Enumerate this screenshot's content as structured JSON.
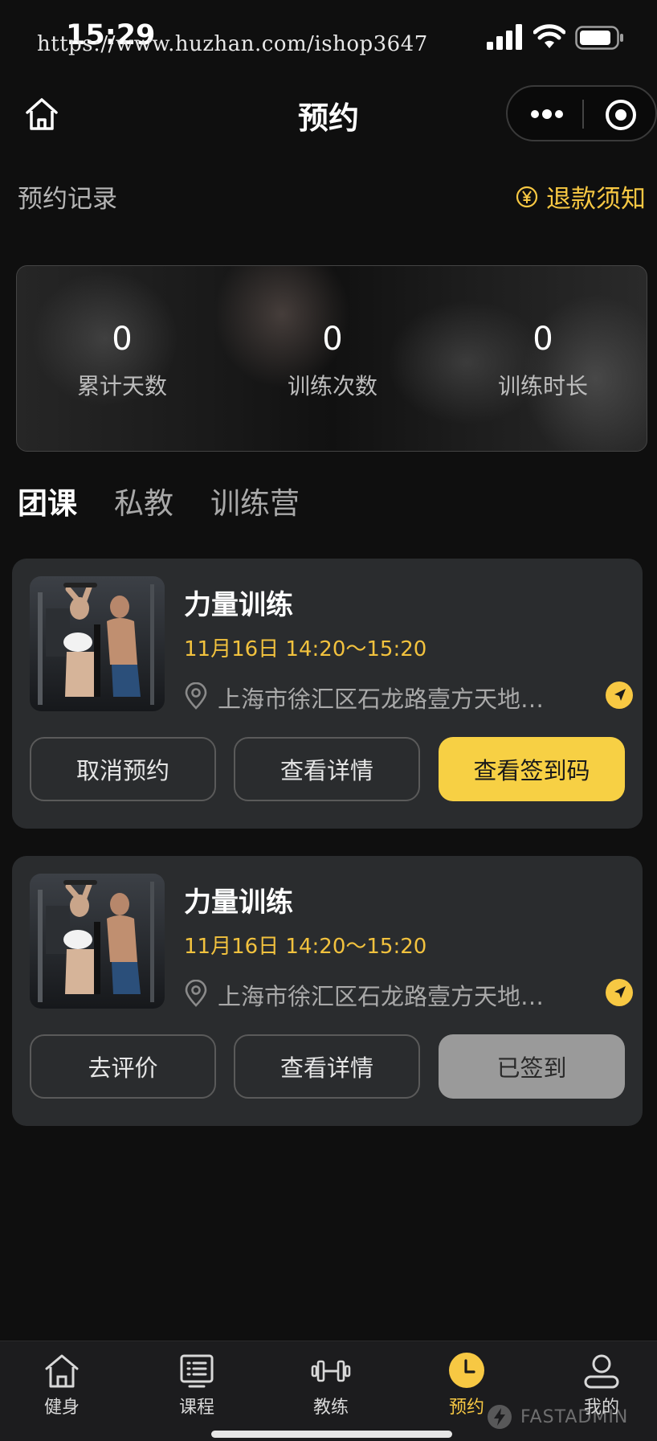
{
  "status_bar": {
    "time": "15:29",
    "watermark_url": "https://www.huzhan.com/ishop3647"
  },
  "nav": {
    "title": "预约"
  },
  "records": {
    "title": "预约记录",
    "refund_label": "退款须知"
  },
  "stats": [
    {
      "value": "0",
      "label": "累计天数"
    },
    {
      "value": "0",
      "label": "训练次数"
    },
    {
      "value": "0",
      "label": "训练时长"
    }
  ],
  "tabs": [
    {
      "label": "团课",
      "active": true
    },
    {
      "label": "私教",
      "active": false
    },
    {
      "label": "训练营",
      "active": false
    }
  ],
  "bookings": [
    {
      "title": "力量训练",
      "time": "11月16日 14:20～15:20",
      "address": "上海市徐汇区石龙路壹方天地…",
      "buttons": [
        "取消预约",
        "查看详情",
        "查看签到码"
      ]
    },
    {
      "title": "力量训练",
      "time": "11月16日 14:20～15:20",
      "address": "上海市徐汇区石龙路壹方天地…",
      "buttons": [
        "去评价",
        "查看详情",
        "已签到"
      ]
    }
  ],
  "tabbar": [
    {
      "label": "健身",
      "icon": "home-icon"
    },
    {
      "label": "课程",
      "icon": "list-icon"
    },
    {
      "label": "教练",
      "icon": "dumbbell-icon"
    },
    {
      "label": "预约",
      "icon": "clock-icon",
      "active": true
    },
    {
      "label": "我的",
      "icon": "user-icon"
    }
  ],
  "watermark_brand": "FASTADMIN",
  "colors": {
    "accent": "#f7c843",
    "background": "#0f0f0f",
    "card": "#2a2c2e"
  }
}
